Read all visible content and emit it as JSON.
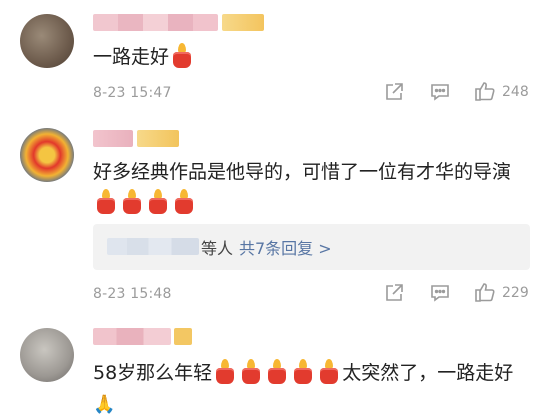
{
  "comments": [
    {
      "text": "一路走好",
      "timestamp": "8-23 15:47",
      "likes": "248",
      "reply_suffix": "",
      "reply_link": ""
    },
    {
      "text": "好多经典作品是他导的，可惜了一位有才华的导演",
      "timestamp": "8-23 15:48",
      "likes": "229",
      "reply_suffix": "等人",
      "reply_link": "共7条回复 >"
    },
    {
      "text_before": "58岁那么年轻",
      "text_after": "太突然了，一路走好"
    }
  ],
  "icons": {
    "share": "share-icon",
    "comment": "comment-icon",
    "like": "thumbs-up-icon",
    "candle": "candle-emoji",
    "pray": "praying-hands-emoji"
  },
  "colors": {
    "link": "#5876a4",
    "meta": "#9b9b9b",
    "candle": "#e23b2e",
    "flame": "#f7b733"
  }
}
